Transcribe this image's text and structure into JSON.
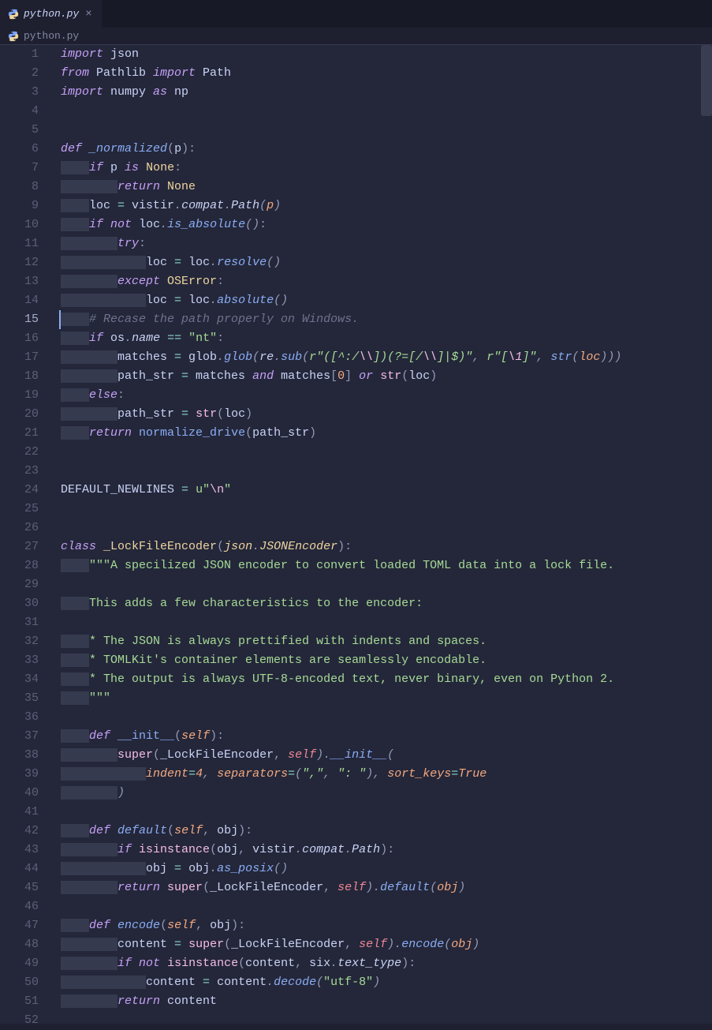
{
  "tab": {
    "filename": "python.py"
  },
  "breadcrumb": {
    "filename": "python.py"
  },
  "lines": [
    {
      "n": 1,
      "segs": [
        [
          "kw",
          "import"
        ],
        [
          "text",
          " json"
        ]
      ]
    },
    {
      "n": 2,
      "segs": [
        [
          "kw",
          "from"
        ],
        [
          "text",
          " Pathlib "
        ],
        [
          "kw",
          "import"
        ],
        [
          "text",
          " Path"
        ]
      ]
    },
    {
      "n": 3,
      "segs": [
        [
          "kw",
          "import"
        ],
        [
          "text",
          " numpy "
        ],
        [
          "kw",
          "as"
        ],
        [
          "text",
          " np"
        ]
      ]
    },
    {
      "n": 4,
      "segs": []
    },
    {
      "n": 5,
      "segs": []
    },
    {
      "n": 6,
      "segs": [
        [
          "kw",
          "def"
        ],
        [
          "text",
          " "
        ],
        [
          "fn-it",
          "_normalized"
        ],
        [
          "punct",
          "("
        ],
        [
          "text",
          "p"
        ],
        [
          "punct",
          "):"
        ]
      ]
    },
    {
      "n": 7,
      "indent": 4,
      "segs": [
        [
          "kw",
          "if"
        ],
        [
          "text",
          " p "
        ],
        [
          "kw",
          "is"
        ],
        [
          "text",
          " "
        ],
        [
          "none",
          "None"
        ],
        [
          "punct",
          ":"
        ]
      ]
    },
    {
      "n": 8,
      "indent": 8,
      "segs": [
        [
          "kw",
          "return"
        ],
        [
          "text",
          " "
        ],
        [
          "none",
          "None"
        ]
      ]
    },
    {
      "n": 9,
      "indent": 4,
      "segs": [
        [
          "text",
          "loc "
        ],
        [
          "op",
          "="
        ],
        [
          "text",
          " vistir"
        ],
        [
          "punct-it",
          "."
        ],
        [
          "text-it",
          "compat"
        ],
        [
          "punct-it",
          "."
        ],
        [
          "text-it",
          "Path"
        ],
        [
          "punct-it",
          "("
        ],
        [
          "param-it",
          "p"
        ],
        [
          "punct-it",
          ")"
        ]
      ]
    },
    {
      "n": 10,
      "indent": 4,
      "segs": [
        [
          "kw",
          "if"
        ],
        [
          "text",
          " "
        ],
        [
          "kw",
          "not"
        ],
        [
          "text",
          " loc"
        ],
        [
          "punct-it",
          "."
        ],
        [
          "fn-it",
          "is_absolute"
        ],
        [
          "punct-it",
          "()"
        ],
        [
          "punct",
          ":"
        ]
      ]
    },
    {
      "n": 11,
      "indent": 8,
      "segs": [
        [
          "kw",
          "try"
        ],
        [
          "punct",
          ":"
        ]
      ]
    },
    {
      "n": 12,
      "indent": 12,
      "segs": [
        [
          "text",
          "loc "
        ],
        [
          "op",
          "="
        ],
        [
          "text",
          " loc"
        ],
        [
          "punct-it",
          "."
        ],
        [
          "fn-it",
          "resolve"
        ],
        [
          "punct-it",
          "()"
        ]
      ]
    },
    {
      "n": 13,
      "indent": 8,
      "segs": [
        [
          "kw",
          "except"
        ],
        [
          "text",
          " "
        ],
        [
          "type",
          "OSError"
        ],
        [
          "punct",
          ":"
        ]
      ]
    },
    {
      "n": 14,
      "indent": 12,
      "segs": [
        [
          "text",
          "loc "
        ],
        [
          "op",
          "="
        ],
        [
          "text",
          " loc"
        ],
        [
          "punct-it",
          "."
        ],
        [
          "fn-it",
          "absolute"
        ],
        [
          "punct-it",
          "()"
        ]
      ]
    },
    {
      "n": 15,
      "indent": 4,
      "hl": true,
      "segs": [
        [
          "comment",
          "# Recase the path properly on Windows."
        ]
      ]
    },
    {
      "n": 16,
      "indent": 4,
      "segs": [
        [
          "kw",
          "if"
        ],
        [
          "text",
          " os"
        ],
        [
          "punct-it",
          "."
        ],
        [
          "text-it",
          "name"
        ],
        [
          "text",
          " "
        ],
        [
          "op",
          "=="
        ],
        [
          "text",
          " "
        ],
        [
          "str",
          "\"nt\""
        ],
        [
          "punct",
          ":"
        ]
      ]
    },
    {
      "n": 17,
      "indent": 8,
      "segs": [
        [
          "text",
          "matches "
        ],
        [
          "op",
          "="
        ],
        [
          "text",
          " glob"
        ],
        [
          "punct-it",
          "."
        ],
        [
          "fn-it",
          "glob"
        ],
        [
          "punct-it",
          "("
        ],
        [
          "text-it",
          "re"
        ],
        [
          "punct-it",
          "."
        ],
        [
          "fn-it",
          "sub"
        ],
        [
          "punct-it",
          "("
        ],
        [
          "str-it",
          "r"
        ],
        [
          "str-it",
          "\"([^:/"
        ],
        [
          "esc-it",
          "\\\\"
        ],
        [
          "str-it",
          "])(?=[/"
        ],
        [
          "esc-it",
          "\\\\"
        ],
        [
          "str-it",
          "]|$)\""
        ],
        [
          "punct-it",
          ", "
        ],
        [
          "str-it",
          "r"
        ],
        [
          "str-it",
          "\"["
        ],
        [
          "esc-it",
          "\\1"
        ],
        [
          "str-it",
          "]\""
        ],
        [
          "punct-it",
          ", "
        ],
        [
          "fn-it",
          "str"
        ],
        [
          "punct-it",
          "("
        ],
        [
          "param-it",
          "loc"
        ],
        [
          "punct-it",
          ")))"
        ]
      ]
    },
    {
      "n": 18,
      "indent": 8,
      "segs": [
        [
          "text",
          "path_str "
        ],
        [
          "op",
          "="
        ],
        [
          "text",
          " matches "
        ],
        [
          "kw",
          "and"
        ],
        [
          "text",
          " matches"
        ],
        [
          "punct",
          "["
        ],
        [
          "num",
          "0"
        ],
        [
          "punct",
          "]"
        ],
        [
          "text",
          " "
        ],
        [
          "kw",
          "or"
        ],
        [
          "text",
          " "
        ],
        [
          "builtin",
          "str"
        ],
        [
          "punct",
          "("
        ],
        [
          "text",
          "loc"
        ],
        [
          "punct",
          ")"
        ]
      ]
    },
    {
      "n": 19,
      "indent": 4,
      "segs": [
        [
          "kw",
          "else"
        ],
        [
          "punct",
          ":"
        ]
      ]
    },
    {
      "n": 20,
      "indent": 8,
      "segs": [
        [
          "text",
          "path_str "
        ],
        [
          "op",
          "="
        ],
        [
          "text",
          " "
        ],
        [
          "builtin",
          "str"
        ],
        [
          "punct",
          "("
        ],
        [
          "text",
          "loc"
        ],
        [
          "punct",
          ")"
        ]
      ]
    },
    {
      "n": 21,
      "indent": 4,
      "segs": [
        [
          "kw",
          "return"
        ],
        [
          "text",
          " "
        ],
        [
          "fn",
          "normalize_drive"
        ],
        [
          "punct",
          "("
        ],
        [
          "text",
          "path_str"
        ],
        [
          "punct",
          ")"
        ]
      ]
    },
    {
      "n": 22,
      "segs": []
    },
    {
      "n": 23,
      "segs": []
    },
    {
      "n": 24,
      "segs": [
        [
          "text",
          "DEFAULT_NEWLINES "
        ],
        [
          "op",
          "="
        ],
        [
          "text",
          " "
        ],
        [
          "str",
          "u"
        ],
        [
          "str",
          "\""
        ],
        [
          "esc",
          "\\n"
        ],
        [
          "str",
          "\""
        ]
      ]
    },
    {
      "n": 25,
      "segs": []
    },
    {
      "n": 26,
      "segs": []
    },
    {
      "n": 27,
      "segs": [
        [
          "kw",
          "class"
        ],
        [
          "text",
          " "
        ],
        [
          "type",
          "_LockFileEncoder"
        ],
        [
          "punct",
          "("
        ],
        [
          "type-it",
          "json"
        ],
        [
          "punct-it",
          "."
        ],
        [
          "type-it",
          "JSONEncoder"
        ],
        [
          "punct",
          "):"
        ]
      ]
    },
    {
      "n": 28,
      "indent": 4,
      "segs": [
        [
          "str",
          "\"\"\"A specilized JSON encoder to convert loaded TOML data into a lock file."
        ]
      ]
    },
    {
      "n": 29,
      "indent": 0,
      "segs": []
    },
    {
      "n": 30,
      "indent": 4,
      "segs": [
        [
          "str",
          "This adds a few characteristics to the encoder:"
        ]
      ]
    },
    {
      "n": 31,
      "indent": 0,
      "segs": []
    },
    {
      "n": 32,
      "indent": 4,
      "segs": [
        [
          "str",
          "* The JSON is always prettified with indents and spaces."
        ]
      ]
    },
    {
      "n": 33,
      "indent": 4,
      "segs": [
        [
          "str",
          "* TOMLKit's container elements are seamlessly encodable."
        ]
      ]
    },
    {
      "n": 34,
      "indent": 4,
      "segs": [
        [
          "str",
          "* The output is always UTF-8-encoded text, never binary, even on Python 2."
        ]
      ]
    },
    {
      "n": 35,
      "indent": 4,
      "segs": [
        [
          "str",
          "\"\"\""
        ]
      ]
    },
    {
      "n": 36,
      "segs": []
    },
    {
      "n": 37,
      "indent": 4,
      "segs": [
        [
          "kw",
          "def"
        ],
        [
          "text",
          " "
        ],
        [
          "fn",
          "__init__"
        ],
        [
          "punct",
          "("
        ],
        [
          "param-it",
          "self"
        ],
        [
          "punct",
          "):"
        ]
      ]
    },
    {
      "n": 38,
      "indent": 8,
      "segs": [
        [
          "builtin",
          "super"
        ],
        [
          "punct",
          "("
        ],
        [
          "text",
          "_LockFileEncoder"
        ],
        [
          "punct",
          ","
        ],
        [
          "text",
          " "
        ],
        [
          "self-it",
          "self"
        ],
        [
          "punct-it",
          ")."
        ],
        [
          "fn-it",
          "__init__"
        ],
        [
          "punct-it",
          "("
        ]
      ]
    },
    {
      "n": 39,
      "indent": 12,
      "segs": [
        [
          "param-it",
          "indent"
        ],
        [
          "op-it",
          "="
        ],
        [
          "num-it",
          "4"
        ],
        [
          "punct-it",
          ", "
        ],
        [
          "param-it",
          "separators"
        ],
        [
          "op-it",
          "="
        ],
        [
          "punct-it",
          "("
        ],
        [
          "str-it",
          "\",\""
        ],
        [
          "punct-it",
          ", "
        ],
        [
          "str-it",
          "\": \""
        ],
        [
          "punct-it",
          ")"
        ],
        [
          "punct-it",
          ", "
        ],
        [
          "param-it",
          "sort_keys"
        ],
        [
          "op-it",
          "="
        ],
        [
          "bool",
          "True"
        ]
      ]
    },
    {
      "n": 40,
      "indent": 8,
      "segs": [
        [
          "punct-it",
          ")"
        ]
      ]
    },
    {
      "n": 41,
      "segs": []
    },
    {
      "n": 42,
      "indent": 4,
      "segs": [
        [
          "kw",
          "def"
        ],
        [
          "text",
          " "
        ],
        [
          "fn-it",
          "default"
        ],
        [
          "punct",
          "("
        ],
        [
          "param-it",
          "self"
        ],
        [
          "punct",
          ", "
        ],
        [
          "text",
          "obj"
        ],
        [
          "punct",
          "):"
        ]
      ]
    },
    {
      "n": 43,
      "indent": 8,
      "segs": [
        [
          "kw",
          "if"
        ],
        [
          "text",
          " "
        ],
        [
          "builtin",
          "isinstance"
        ],
        [
          "punct",
          "("
        ],
        [
          "text",
          "obj"
        ],
        [
          "punct",
          ","
        ],
        [
          "text",
          " vistir"
        ],
        [
          "punct-it",
          "."
        ],
        [
          "text-it",
          "compat"
        ],
        [
          "punct-it",
          "."
        ],
        [
          "text-it",
          "Path"
        ],
        [
          "punct",
          "):"
        ]
      ]
    },
    {
      "n": 44,
      "indent": 12,
      "segs": [
        [
          "text",
          "obj "
        ],
        [
          "op",
          "="
        ],
        [
          "text",
          " obj"
        ],
        [
          "punct-it",
          "."
        ],
        [
          "fn-it",
          "as_posix"
        ],
        [
          "punct-it",
          "()"
        ]
      ]
    },
    {
      "n": 45,
      "indent": 8,
      "segs": [
        [
          "kw",
          "return"
        ],
        [
          "text",
          " "
        ],
        [
          "builtin",
          "super"
        ],
        [
          "punct",
          "("
        ],
        [
          "text",
          "_LockFileEncoder"
        ],
        [
          "punct",
          ","
        ],
        [
          "text",
          " "
        ],
        [
          "self-it",
          "self"
        ],
        [
          "punct-it",
          ")."
        ],
        [
          "fn-it",
          "default"
        ],
        [
          "punct-it",
          "("
        ],
        [
          "param-it",
          "obj"
        ],
        [
          "punct-it",
          ")"
        ]
      ]
    },
    {
      "n": 46,
      "segs": []
    },
    {
      "n": 47,
      "indent": 4,
      "segs": [
        [
          "kw",
          "def"
        ],
        [
          "text",
          " "
        ],
        [
          "fn-it",
          "encode"
        ],
        [
          "punct",
          "("
        ],
        [
          "param-it",
          "self"
        ],
        [
          "punct",
          ", "
        ],
        [
          "text",
          "obj"
        ],
        [
          "punct",
          "):"
        ]
      ]
    },
    {
      "n": 48,
      "indent": 8,
      "segs": [
        [
          "text",
          "content "
        ],
        [
          "op",
          "="
        ],
        [
          "text",
          " "
        ],
        [
          "builtin",
          "super"
        ],
        [
          "punct",
          "("
        ],
        [
          "text",
          "_LockFileEncoder"
        ],
        [
          "punct",
          ","
        ],
        [
          "text",
          " "
        ],
        [
          "self-it",
          "self"
        ],
        [
          "punct-it",
          ")."
        ],
        [
          "fn-it",
          "encode"
        ],
        [
          "punct-it",
          "("
        ],
        [
          "param-it",
          "obj"
        ],
        [
          "punct-it",
          ")"
        ]
      ]
    },
    {
      "n": 49,
      "indent": 8,
      "segs": [
        [
          "kw",
          "if"
        ],
        [
          "text",
          " "
        ],
        [
          "kw",
          "not"
        ],
        [
          "text",
          " "
        ],
        [
          "builtin",
          "isinstance"
        ],
        [
          "punct",
          "("
        ],
        [
          "text",
          "content"
        ],
        [
          "punct",
          ","
        ],
        [
          "text",
          " six"
        ],
        [
          "punct-it",
          "."
        ],
        [
          "text-it",
          "text_type"
        ],
        [
          "punct",
          "):"
        ]
      ]
    },
    {
      "n": 50,
      "indent": 12,
      "segs": [
        [
          "text",
          "content "
        ],
        [
          "op",
          "="
        ],
        [
          "text",
          " content"
        ],
        [
          "punct-it",
          "."
        ],
        [
          "fn-it",
          "decode"
        ],
        [
          "punct-it",
          "("
        ],
        [
          "str",
          "\"utf-8\""
        ],
        [
          "punct-it",
          ")"
        ]
      ]
    },
    {
      "n": 51,
      "indent": 8,
      "segs": [
        [
          "kw",
          "return"
        ],
        [
          "text",
          " content"
        ]
      ]
    },
    {
      "n": 52,
      "segs": []
    }
  ]
}
